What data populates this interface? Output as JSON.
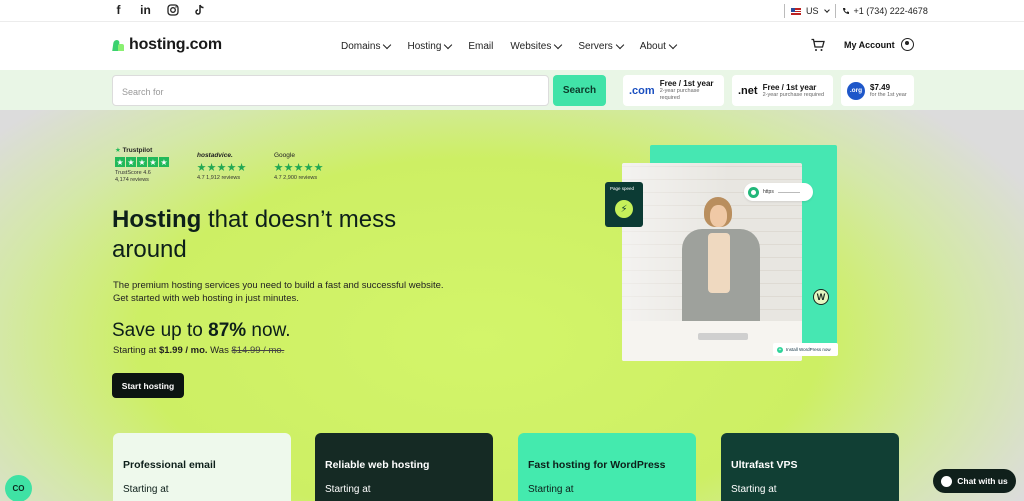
{
  "social": {
    "icons": [
      "facebook-icon",
      "linkedin-icon",
      "instagram-icon",
      "tiktok-icon"
    ]
  },
  "topbar": {
    "locale": "US",
    "phone": "+1 (734) 222-4678"
  },
  "brand": {
    "name": "hosting.com",
    "accent": "#41e3a8",
    "dark": "#0c1411",
    "lime": "#cdef64"
  },
  "nav": {
    "items": [
      {
        "label": "Domains",
        "dropdown": true
      },
      {
        "label": "Hosting",
        "dropdown": true
      },
      {
        "label": "Email",
        "dropdown": false
      },
      {
        "label": "Websites",
        "dropdown": true
      },
      {
        "label": "Servers",
        "dropdown": true
      },
      {
        "label": "About",
        "dropdown": true
      }
    ],
    "account_label": "My Account"
  },
  "search": {
    "placeholder": "Search for",
    "button_label": "Search",
    "tlds": [
      {
        "name": ".com",
        "price": "Free / 1st year",
        "note": "2-year purchase required"
      },
      {
        "name": ".net",
        "price": "Free / 1st year",
        "note": "2-year purchase required"
      },
      {
        "name": ".org",
        "price": "$7.49",
        "note": "for the 1st year"
      }
    ]
  },
  "ratings": [
    {
      "brand": "Trustpilot",
      "meta1": "TrustScore 4.6",
      "meta2": "4,174 reviews"
    },
    {
      "brand": "hostadvice.",
      "meta1": "4.7 1,912 reviews",
      "meta2": ""
    },
    {
      "brand": "Google",
      "meta1": "4.7 2,900 reviews",
      "meta2": ""
    }
  ],
  "hero": {
    "headline_bold": "Hosting",
    "headline_rest": " that doesn’t mess around",
    "sub_line1": "The premium hosting services you need to build a fast and successful website.",
    "sub_line2": "Get started with web hosting in just minutes.",
    "save_prefix": "Save up to ",
    "save_percent": "87%",
    "save_suffix": " now.",
    "starting_prefix": "Starting at ",
    "price": "$1.99 / mo.",
    "was_prefix": " Was ",
    "old_price": "$14.99 / mo.",
    "cta": "Start hosting"
  },
  "visual": {
    "page_speed_label": "Page speed",
    "url_text": "https",
    "install_label": "Install WordPress now"
  },
  "cards": [
    {
      "title": "Professional email",
      "starting": "Starting at"
    },
    {
      "title": "Reliable web hosting",
      "starting": "Starting at"
    },
    {
      "title": "Fast hosting for WordPress",
      "starting": "Starting at"
    },
    {
      "title": "Ultrafast VPS",
      "starting": "Starting at"
    }
  ],
  "floating": {
    "co_label": "CO",
    "chat_label": "Chat with us"
  }
}
